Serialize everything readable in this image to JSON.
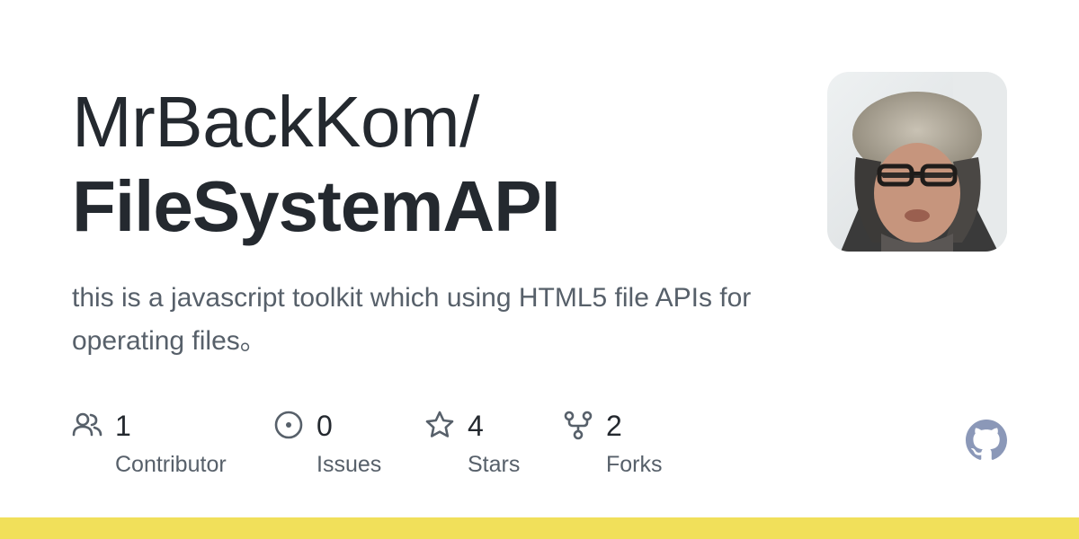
{
  "repo": {
    "owner": "MrBackKom/",
    "name": "FileSystemAPI",
    "description": "this is a javascript toolkit which using HTML5 file APIs for operating files。"
  },
  "stats": [
    {
      "icon": "people-icon",
      "value": "1",
      "label": "Contributor"
    },
    {
      "icon": "issue-icon",
      "value": "0",
      "label": "Issues"
    },
    {
      "icon": "star-icon",
      "value": "4",
      "label": "Stars"
    },
    {
      "icon": "fork-icon",
      "value": "2",
      "label": "Forks"
    }
  ],
  "colors": {
    "text_primary": "#24292f",
    "text_secondary": "#57606a",
    "bottom_bar": "#f1e05a",
    "github_logo": "#8b98b8"
  }
}
